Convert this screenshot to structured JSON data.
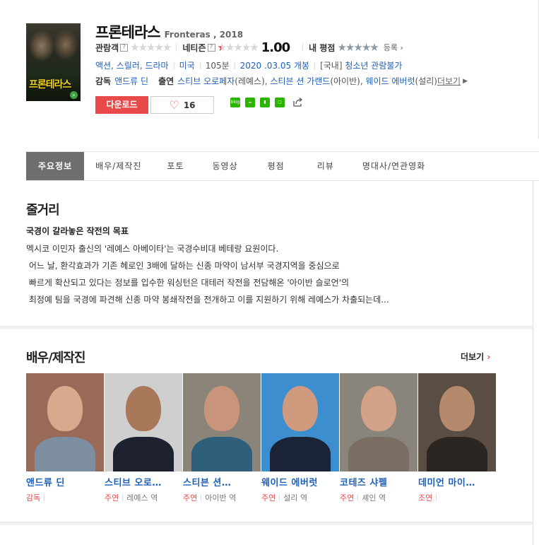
{
  "movie": {
    "title_ko": "프론테라스",
    "title_en": "Fronteras , 2018",
    "poster_title": "프론테라스"
  },
  "ratings": {
    "audience_label": "관람객",
    "netizen_label": "네티즌",
    "netizen_score": "1.00",
    "netizen_stars_fraction": 0.1,
    "my_label": "내 평점",
    "register_label": "등록",
    "help_mark": "?"
  },
  "info": {
    "genres": "액션, 스릴러, 드라마",
    "country": "미국",
    "runtime": "105분",
    "release": "2020 .03.05 개봉",
    "grade_prefix": "[국내]",
    "grade": "청소년 관람불가"
  },
  "credits": {
    "director_label": "감독",
    "director": "앤드류 딘",
    "cast_label": "출연",
    "cast_1": "스티브 오로페자",
    "cast_1_role": "(레예스)",
    "cast_2": "스티븐 션 가랜드",
    "cast_2_role": "(아이반)",
    "cast_3": "웨이드 에버럿",
    "cast_3_role": "(설리)",
    "more": "더보기"
  },
  "buttons": {
    "download": "다운로드",
    "like_count": "16",
    "blog_label": "blog"
  },
  "tabs": [
    "주요정보",
    "배우/제작진",
    "포토",
    "동영상",
    "평점",
    "리뷰",
    "명대사/연관영화"
  ],
  "synopsis": {
    "heading": "줄거리",
    "title": "국경이 갈라놓은 작전의 목표",
    "lines": [
      "멕시코 이민자 출신의 '레예스 아베이타'는 국경수비대 베테랑 요원이다.",
      " 어느 날, 환각효과가 기존 헤로인 3배에 달하는 신종 마약이 남서부 국경지역을 중심으로",
      " 빠르게 확산되고 있다는 정보를 입수한 워싱턴은 대테러 작전을 전담해온 '아이반 슬로언'의",
      " 최정예 팀을 국경에 파견해 신종 마약 봉쇄작전을 전개하고 이를 지원하기 위해 레예스가 차출되는데..."
    ]
  },
  "cast_section": {
    "heading": "배우/제작진",
    "more": "더보기",
    "people": [
      {
        "name": "앤드류 딘",
        "role": "감독",
        "character": "",
        "bg": "#9a6a58",
        "skin": "#d8a98c",
        "cloth": "#7d8ea0"
      },
      {
        "name": "스티브 오로…",
        "role": "주연",
        "character": "레예스 역",
        "bg": "#cfcfcf",
        "skin": "#a9775a",
        "cloth": "#1e2230"
      },
      {
        "name": "스티븐 션…",
        "role": "주연",
        "character": "아이반 역",
        "bg": "#8a8578",
        "skin": "#c99479",
        "cloth": "#2f5f7a"
      },
      {
        "name": "웨이드 에버럿",
        "role": "주연",
        "character": "설리 역",
        "bg": "#3d8ecf",
        "skin": "#d09a7e",
        "cloth": "#1b2436"
      },
      {
        "name": "코테즈 샤펠",
        "role": "주연",
        "character": "셰인 역",
        "bg": "#8a857c",
        "skin": "#d2a288",
        "cloth": "#7a6e63"
      },
      {
        "name": "데미언 마이…",
        "role": "조연",
        "character": "",
        "bg": "#5a4e44",
        "skin": "#b58a6c",
        "cloth": "#2b2622"
      }
    ]
  }
}
